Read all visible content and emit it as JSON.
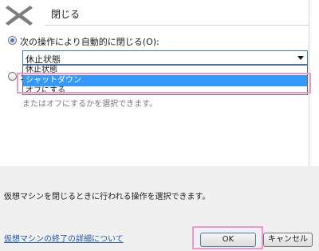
{
  "header": {
    "title": "閉じる",
    "icon": "close-icon"
  },
  "options": {
    "auto_close_label": "次の操作により自動的に閉じる(O):",
    "second_option_label": "オ",
    "selected_value": "休止状態",
    "dropdown_items": [
      "休止状態",
      "シャットダウン",
      "オフにする"
    ],
    "highlighted_item": "シャットダウン",
    "description": "またはオフにするかを選択できます。"
  },
  "footer": {
    "info_text": "仮想マシンを閉じるときに行われる操作を選択できます。",
    "help_link": "仮想マシンの終了の詳細について",
    "ok_label": "OK",
    "cancel_label": "キャンセル"
  },
  "colors": {
    "highlight_border": "#ee99c8",
    "selection": "#3399ff",
    "link": "#1e5aa8"
  }
}
